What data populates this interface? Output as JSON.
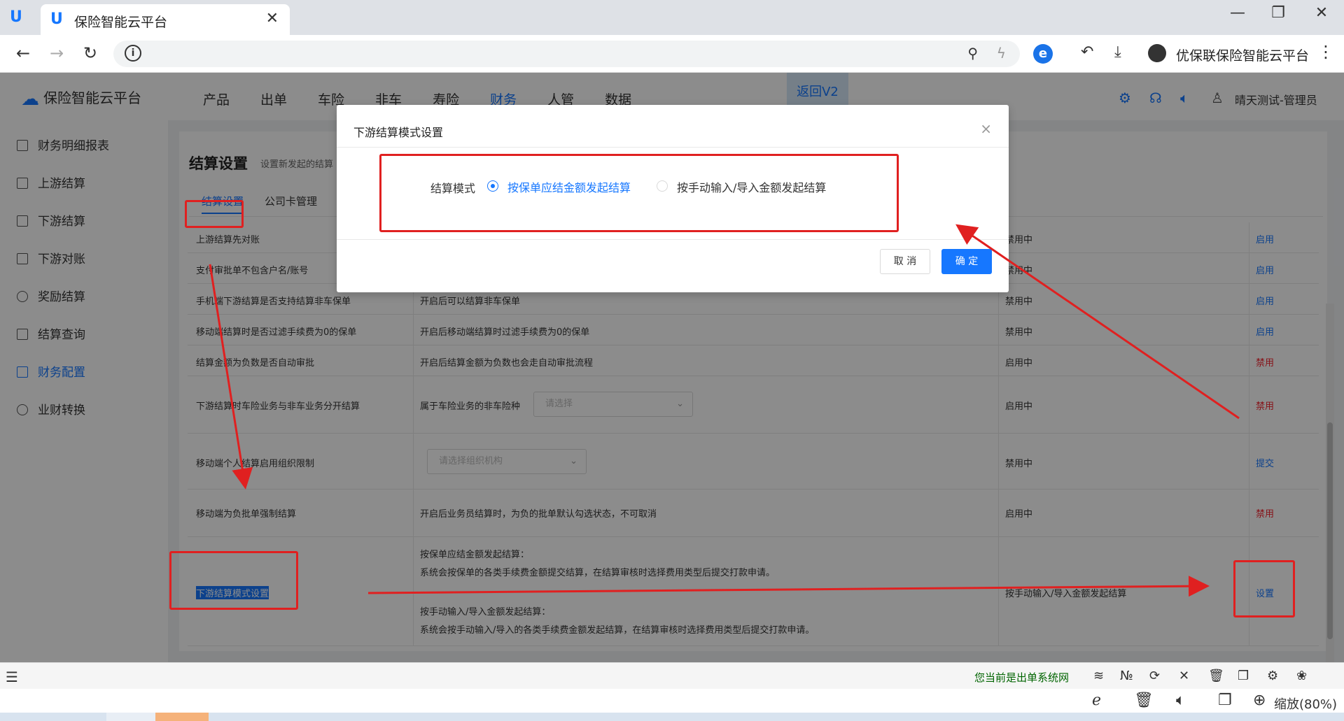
{
  "browser": {
    "tab_title": "保险智能云平台",
    "profile_name": "优保联保险智能云平台"
  },
  "app": {
    "brand": "保险智能云平台",
    "nav": [
      "产品",
      "出单",
      "车险",
      "非车",
      "寿险",
      "财务",
      "人管",
      "数据"
    ],
    "active_nav": "财务",
    "return_label": "返回V2",
    "user": "晴天测试-管理员"
  },
  "sidebar": {
    "items": [
      {
        "label": "财务明细报表"
      },
      {
        "label": "上游结算"
      },
      {
        "label": "下游结算"
      },
      {
        "label": "下游对账"
      },
      {
        "label": "奖励结算"
      },
      {
        "label": "结算查询"
      },
      {
        "label": "财务配置"
      },
      {
        "label": "业财转换"
      }
    ]
  },
  "page": {
    "title": "结算设置",
    "subtitle": "设置新发起的结算",
    "tabs": [
      "结算设置",
      "公司卡管理"
    ]
  },
  "table": {
    "rows": [
      {
        "name": "上游结算先对账",
        "desc": "",
        "status": "禁用中",
        "action": "启用"
      },
      {
        "name": "支付审批单不包含户名/账号",
        "desc": "",
        "status": "禁用中",
        "action": "启用"
      },
      {
        "name": "手机端下游结算是否支持结算非车保单",
        "desc": "开启后可以结算非车保单",
        "status": "禁用中",
        "action": "启用"
      },
      {
        "name": "移动端结算时是否过滤手续费为0的保单",
        "desc": "开启后移动端结算时过滤手续费为0的保单",
        "status": "禁用中",
        "action": "启用"
      },
      {
        "name": "结算金额为负数是否自动审批",
        "desc": "开启后结算金额为负数也会走自动审批流程",
        "status": "启用中",
        "action": "禁用"
      },
      {
        "name": "下游结算时车险业务与非车业务分开结算",
        "desc": "属于车险业务的非车险种",
        "select_placeholder": "请选择",
        "status": "启用中",
        "action": "禁用"
      },
      {
        "name": "移动端个人结算启用组织限制",
        "select_placeholder": "请选择组织机构",
        "status": "禁用中",
        "action": "提交"
      },
      {
        "name": "移动端为负批单强制结算",
        "desc": "开启后业务员结算时，为负的批单默认勾选状态，不可取消",
        "status": "启用中",
        "action": "禁用"
      },
      {
        "name": "下游结算模式设置",
        "desc_lines": [
          "按保单应结金额发起结算：",
          "系统会按保单的各类手续费金额提交结算，在结算审核时选择费用类型后提交打款申请。",
          "按手动输入/导入金额发起结算：",
          "系统会按手动输入/导入的各类手续费金额发起结算，在结算审核时选择费用类型后提交打款申请。"
        ],
        "status": "按手动输入/导入金额发起结算",
        "action": "设置"
      }
    ]
  },
  "modal": {
    "title": "下游结算模式设置",
    "field_label": "结算模式",
    "options": [
      "按保单应结金额发起结算",
      "按手动输入/导入金额发起结算"
    ],
    "selected_index": 0,
    "cancel": "取 消",
    "ok": "确 定"
  },
  "status_bar": {
    "network_text": "您当前是出单系统网",
    "zoom_text": "缩放(80%)"
  },
  "colors": {
    "accent": "#1677ff",
    "danger": "#f5222d",
    "annotation": "#e02020"
  }
}
